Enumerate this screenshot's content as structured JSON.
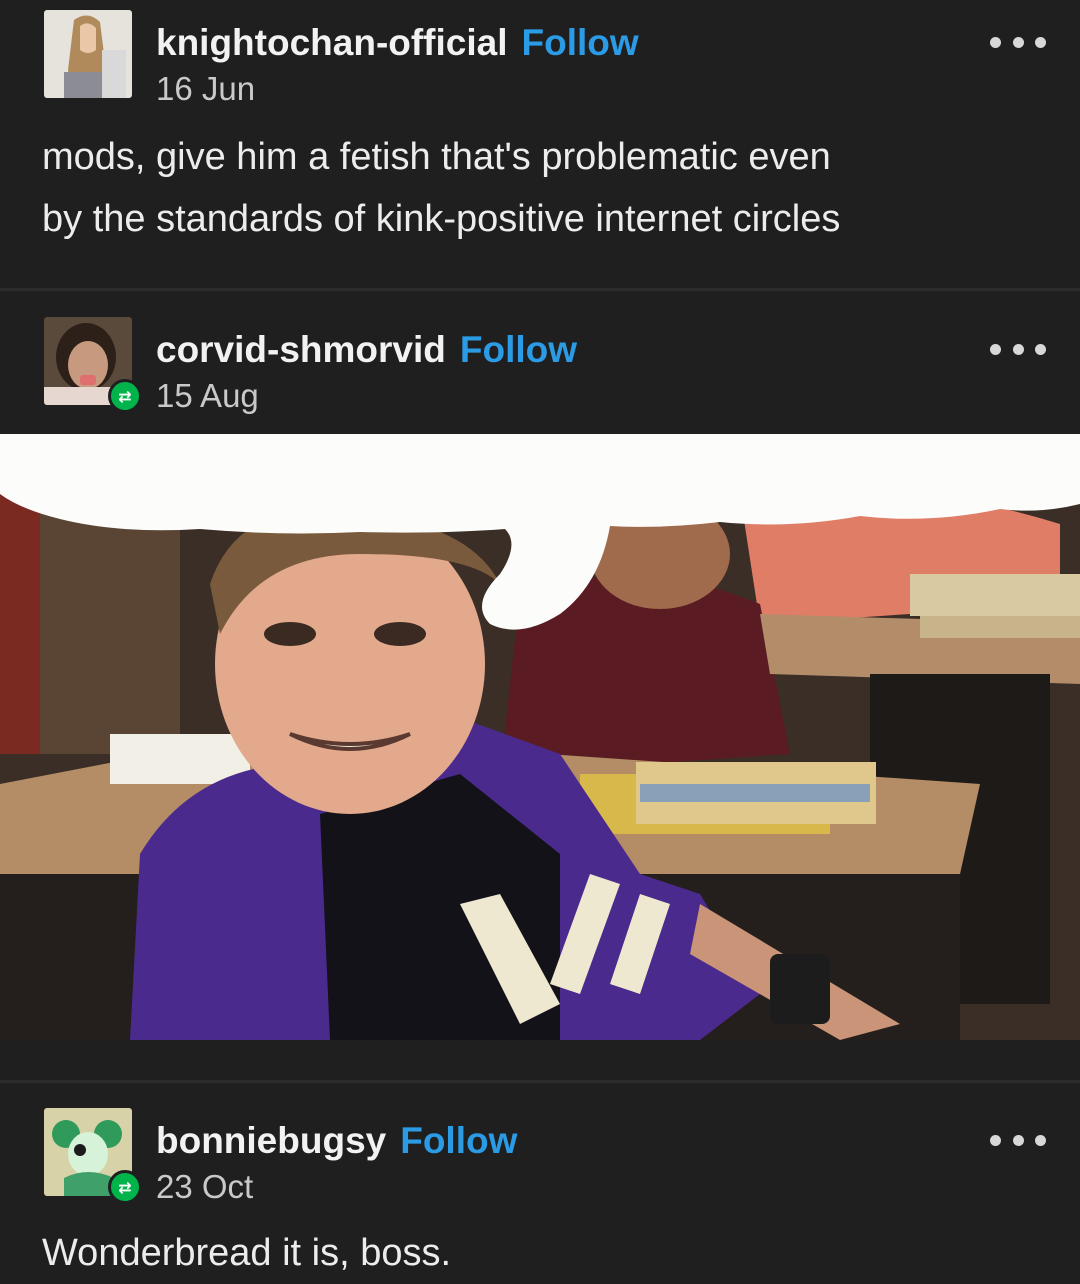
{
  "posts": [
    {
      "username": "knightochan-official",
      "follow_label": "Follow",
      "date": "16 Jun",
      "text_line1": "mods, give him a fetish that's problematic even",
      "text_line2": "by the standards of kink-positive internet circles"
    },
    {
      "username": "corvid-shmorvid",
      "follow_label": "Follow",
      "date": "15 Aug"
    },
    {
      "username": "bonniebugsy",
      "follow_label": "Follow",
      "date": "23 Oct",
      "text_line1": "Wonderbread it is, boss."
    }
  ],
  "icons": {
    "more": "more-options-icon",
    "reblog": "reblog-icon"
  },
  "colors": {
    "background": "#1f1f20",
    "follow": "#2b9be6",
    "reblog_badge": "#00b34a"
  }
}
